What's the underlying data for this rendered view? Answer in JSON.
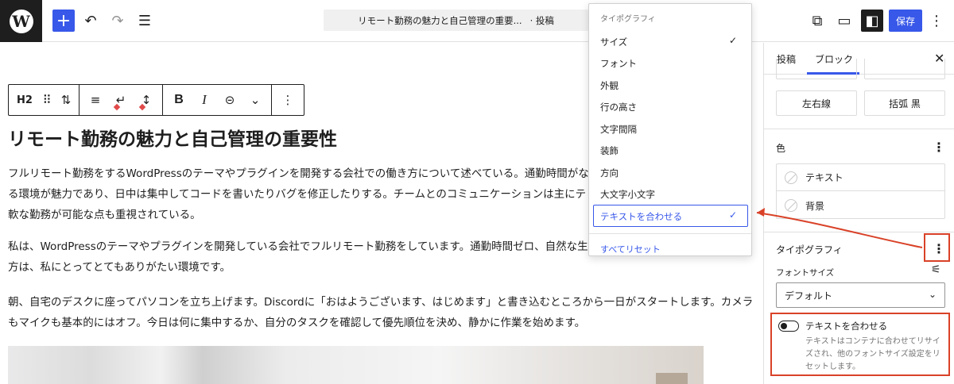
{
  "topbar": {
    "logo": "W",
    "add_icon": "+",
    "undo_icon": "↶",
    "redo_icon": "↷",
    "list_icon": "☰",
    "document_title": "リモート勤務の魅力と自己管理の重要...",
    "document_type": "· 投稿",
    "external_icon": "⧉",
    "preview_icon": "▭",
    "settings_icon": "◧",
    "save_label": "保存",
    "more_icon": "⋮"
  },
  "block_toolbar": {
    "heading_level": "H2",
    "drag_icon": "⠿",
    "move_icon": "⇅",
    "align_icon": "≡",
    "bold": "B",
    "italic": "I",
    "link_icon": "⊝",
    "chevron_icon": "⌄",
    "more_icon": "⋮"
  },
  "content": {
    "title": "リモート勤務の魅力と自己管理の重要性",
    "paragraphs": [
      {
        "lines": [
          "フルリモート勤務をするWordPressのテーマやプラグインを開発する会社での働き方について述べている。通勤時間がな",
          "る環境が魅力であり、日中は集中してコードを書いたりバグを修正したりする。チームとのコミュニケーションは主にテ",
          "軟な勤務が可能な点も重視されている。"
        ]
      },
      {
        "lines": [
          "私は、WordPressのテーマやプラグインを開発している会社でフルリモート勤務をしています。通勤時間ゼロ、自然な生",
          "方は、私にとってとてもありがたい環境です。"
        ]
      },
      {
        "lines": [
          "朝、自宅のデスクに座ってパソコンを立ち上げます。Discordに「おはようございます、はじめます」と書き込むところから一日がスタートします。カメラ",
          "もマイクも基本的にはオフ。今日は何に集中するか、自分のタスクを確認して優先順位を決め、静かに作業を始めます。"
        ]
      }
    ]
  },
  "dropdown": {
    "heading": "タイポグラフィ",
    "items": [
      {
        "label": "サイズ",
        "checked": true
      },
      {
        "label": "フォント",
        "checked": false
      },
      {
        "label": "外観",
        "checked": false
      },
      {
        "label": "行の高さ",
        "checked": false
      },
      {
        "label": "文字間隔",
        "checked": false
      },
      {
        "label": "装飾",
        "checked": false
      },
      {
        "label": "方向",
        "checked": false
      },
      {
        "label": "大文字小文字",
        "checked": false
      }
    ],
    "selected_item": "テキストを合わせる",
    "check_icon": "✓",
    "reset_label": "すべてリセット"
  },
  "sidebar": {
    "tabs": [
      {
        "label": "投稿"
      },
      {
        "label": "ブロック"
      }
    ],
    "close_icon": "✕",
    "styles": [
      {
        "label": ""
      },
      {
        "label": ""
      },
      {
        "label": "左右線"
      },
      {
        "label": "括弧 黒"
      }
    ],
    "color": {
      "title": "色",
      "items": [
        {
          "label": "テキスト"
        },
        {
          "label": "背景"
        }
      ]
    },
    "typography": {
      "title": "タイポグラフィ",
      "font_size_label": "フォントサイズ",
      "font_size_icon": "⚟",
      "font_size_value": "デフォルト",
      "chevron": "⌄",
      "fit_text_label": "テキストを合わせる",
      "fit_text_enabled": false,
      "fit_text_help": "テキストはコンテナに合わせてリサイズされ、他のフォントサイズ設定をリセットします。"
    },
    "more_icon": "⋮"
  },
  "colors": {
    "accent": "#3858e9",
    "annotation": "#d94228"
  }
}
